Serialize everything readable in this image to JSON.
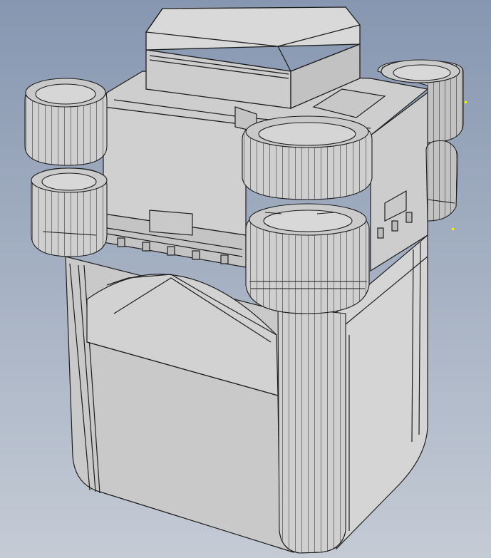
{
  "viewport": {
    "background_top": "#8797b1",
    "background_bottom": "#c4cbd5"
  },
  "model": {
    "face_light": "#d7d7d7",
    "face_mid": "#c6c6c6",
    "face_dark": "#a9a9a9",
    "edge_color": "#1e1e1e",
    "icon": "cad-wireframe-model"
  },
  "selection_points": {
    "color": "#f5f500",
    "count": 2
  }
}
